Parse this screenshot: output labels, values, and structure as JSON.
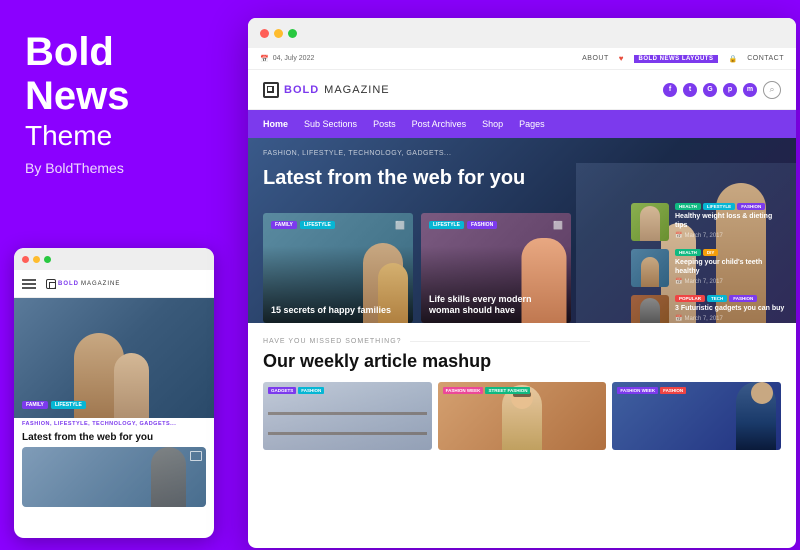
{
  "left_panel": {
    "brand_line1": "Bold",
    "brand_line2": "News",
    "brand_sub": "Theme",
    "by_line": "By BoldThemes"
  },
  "browser": {
    "topbar": {
      "date": "04, July 2022",
      "about": "ABOUT",
      "bold_news_layouts": "BOLD NEWS LAYOUTS",
      "contact": "CONTACT"
    },
    "header": {
      "logo_bold": "BOLD",
      "logo_mag": "MAGAZINE",
      "social_icons": [
        "f",
        "G+",
        "in",
        "m"
      ]
    },
    "nav": {
      "items": [
        "Home",
        "Sub Sections",
        "Posts",
        "Post Archives",
        "Shop",
        "Pages"
      ]
    },
    "hero": {
      "categories": "FASHION, LIFESTYLE, TECHNOLOGY, GADGETS...",
      "title": "Latest from the web for you",
      "card1": {
        "tags": [
          "FAMILY",
          "LIFESTYLE"
        ],
        "title": "15 secrets of happy families"
      },
      "card2": {
        "tags": [
          "LIFESTYLE",
          "FASHION"
        ],
        "title": "Life skills every modern woman should have"
      },
      "sidebar_articles": [
        {
          "tags": [
            "HEALTH",
            "LIFESTYLE",
            "FASHION"
          ],
          "title": "Healthy weight loss & dieting tips",
          "date": "March 7, 2017"
        },
        {
          "tags": [
            "HEALTH",
            "DIY"
          ],
          "title": "Keeping your child's teeth healthy",
          "date": "March 7, 2017"
        },
        {
          "tags": [
            "POPULAR",
            "TECH",
            "FASHION"
          ],
          "title": "3 Futuristic gadgets you can buy",
          "date": "March 7, 2017"
        }
      ]
    },
    "weekly": {
      "hint": "HAVE YOU MISSED SOMETHING?",
      "title": "Our weekly article mashup",
      "cards": [
        {
          "tags": [
            "GADGETS",
            "FASHION"
          ]
        },
        {
          "tags": [
            "FASHION WEEK",
            "STREET FASHION"
          ]
        },
        {
          "tags": [
            "FASHION WEEK",
            "FASHION"
          ]
        }
      ]
    }
  },
  "mobile": {
    "categories": "FASHION, LIFESTYLE, TECHNOLOGY, GADGETS...",
    "hero_title": "Latest from the web for you",
    "card_tags": [
      "FAMILY",
      "LIFESTYLE"
    ]
  }
}
